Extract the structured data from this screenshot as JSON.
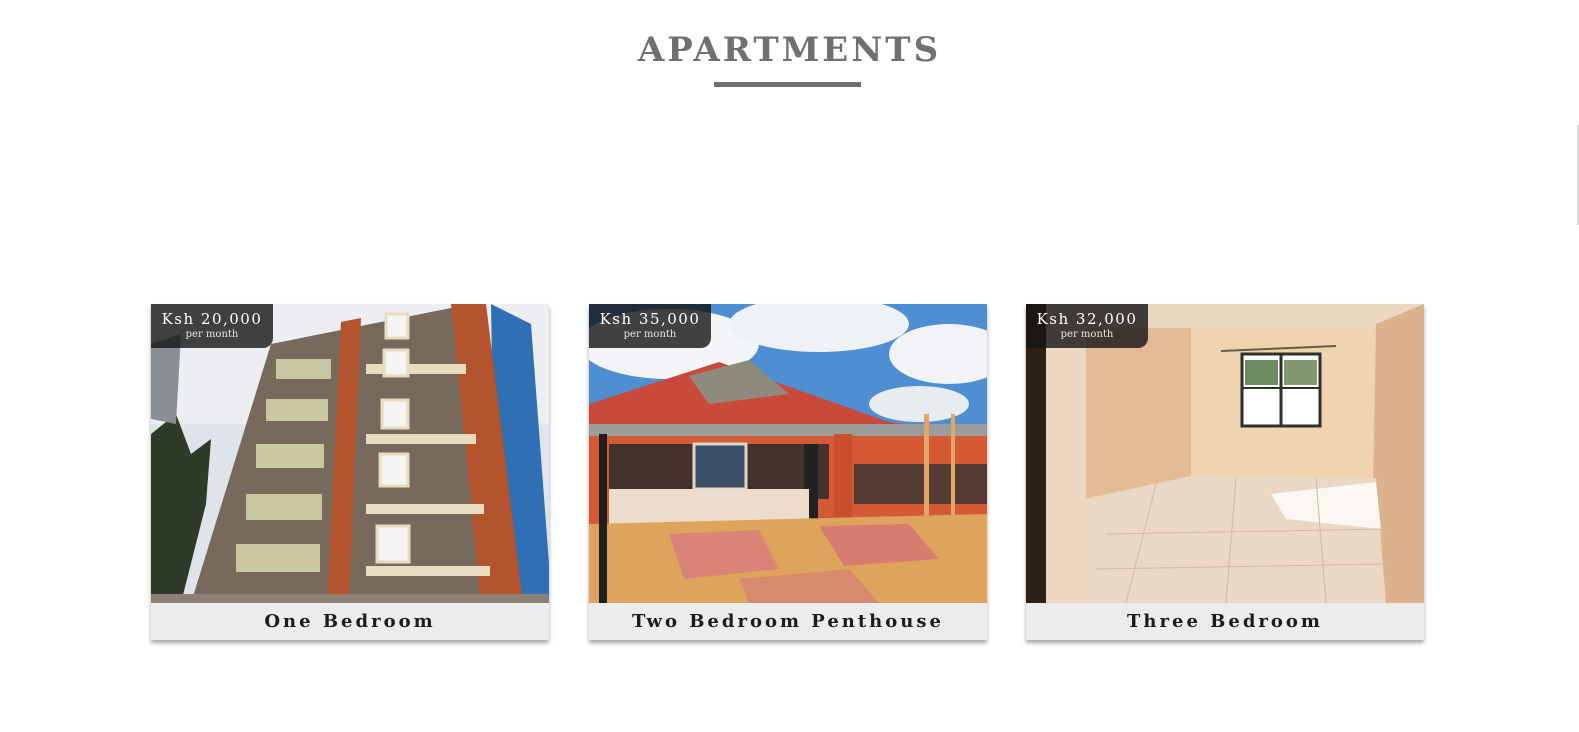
{
  "section": {
    "title": "APARTMENTS"
  },
  "listings": [
    {
      "price": "Ksh 20,000",
      "period": "per month",
      "name": "One Bedroom",
      "image": "apartment-building-exterior"
    },
    {
      "price": "Ksh 35,000",
      "period": "per month",
      "name": "Two Bedroom Penthouse",
      "image": "penthouse-rooftop-terrace"
    },
    {
      "price": "Ksh 32,000",
      "period": "per month",
      "name": "Three Bedroom",
      "image": "empty-tiled-bedroom-interior"
    }
  ],
  "colors": {
    "title": "#707070",
    "underline": "#6f6f6f",
    "badge_bg": "#141414",
    "caption_bg": "#ececec"
  }
}
